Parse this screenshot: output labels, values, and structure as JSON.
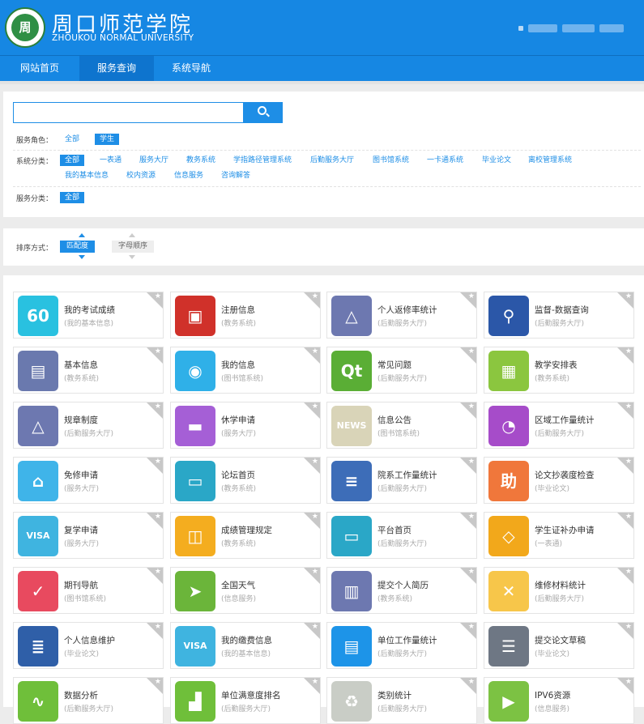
{
  "header": {
    "logo_text": "周",
    "title_cn": "周口师范学院",
    "title_en": "ZHOUKOU NORMAL UNIVERSITY"
  },
  "nav": {
    "items": [
      "网站首页",
      "服务查询",
      "系统导航"
    ],
    "active": 1
  },
  "search": {
    "placeholder": "",
    "button_icon": "search-icon"
  },
  "filters": {
    "role_label": "服务角色：",
    "roles": [
      "全部",
      "学生"
    ],
    "system_label": "系统分类：",
    "systems_row1": [
      "全部",
      "一表通",
      "服务大厅",
      "教务系统",
      "学指路径管理系统",
      "后勤服务大厅",
      "图书馆系统",
      "一卡通系统",
      "毕业论文",
      "离校管理系统"
    ],
    "systems_row2": [
      "我的基本信息",
      "校内资源",
      "信息服务",
      "咨询解答"
    ],
    "category_label": "服务分类：",
    "categories": [
      "全部"
    ]
  },
  "sort": {
    "label": "排序方式：",
    "options": [
      "匹配度",
      "字母顺序"
    ]
  },
  "colors": {
    "primary": "#1687e3",
    "accent": "#1e8ee6"
  },
  "services": [
    {
      "name": "我的考试成绩",
      "sys": "(我的基本信息)",
      "icon": "score-60-icon",
      "color": "#29c1e0",
      "sym": "60"
    },
    {
      "name": "注册信息",
      "sys": "(教务系统)",
      "icon": "id-card-icon",
      "color": "#d0312a",
      "sym": "▣"
    },
    {
      "name": "个人返修率统计",
      "sys": "(后勤服务大厅)",
      "icon": "warning-triangle-icon",
      "color": "#6d78b0",
      "sym": "△"
    },
    {
      "name": "监督-数据查询",
      "sys": "(后勤服务大厅)",
      "icon": "magnifier-icon",
      "color": "#2b57a8",
      "sym": "⚲"
    },
    {
      "name": "基本信息",
      "sys": "(教务系统)",
      "icon": "certificate-icon",
      "color": "#6a79ae",
      "sym": "▤"
    },
    {
      "name": "我的信息",
      "sys": "(图书馆系统)",
      "icon": "user-profile-icon",
      "color": "#2fb0e8",
      "sym": "◉"
    },
    {
      "name": "常见问题",
      "sys": "(后勤服务大厅)",
      "icon": "qt-icon",
      "color": "#5aae35",
      "sym": "Qt"
    },
    {
      "name": "教学安排表",
      "sys": "(教务系统)",
      "icon": "calendar-icon",
      "color": "#8bc63f",
      "sym": "▦"
    },
    {
      "name": "规章制度",
      "sys": "(后勤服务大厅)",
      "icon": "warning-triangle-icon",
      "color": "#6d78b0",
      "sym": "△"
    },
    {
      "name": "休学申请",
      "sys": "(服务大厅)",
      "icon": "bed-icon",
      "color": "#a55fd6",
      "sym": "▬"
    },
    {
      "name": "信息公告",
      "sys": "(图书馆系统)",
      "icon": "news-icon",
      "color": "#d9d4b8",
      "sym": "NEWS"
    },
    {
      "name": "区域工作量统计",
      "sys": "(后勤服务大厅)",
      "icon": "pie-chart-icon",
      "color": "#a64cc9",
      "sym": "◔"
    },
    {
      "name": "免修申请",
      "sys": "(服务大厅)",
      "icon": "school-icon",
      "color": "#3fb4e9",
      "sym": "⌂"
    },
    {
      "name": "论坛首页",
      "sys": "(教务系统)",
      "icon": "monitor-chart-icon",
      "color": "#2aa7c7",
      "sym": "▭"
    },
    {
      "name": "院系工作量统计",
      "sys": "(后勤服务大厅)",
      "icon": "document-icon",
      "color": "#3d6db8",
      "sym": "≡"
    },
    {
      "name": "论文抄袭度检查",
      "sys": "(毕业论文)",
      "icon": "coin-icon",
      "color": "#f0773b",
      "sym": "助"
    },
    {
      "name": "复学申请",
      "sys": "(服务大厅)",
      "icon": "visa-card-icon",
      "color": "#3fb4e0",
      "sym": "VISA"
    },
    {
      "name": "成绩管理规定",
      "sys": "(教务系统)",
      "icon": "card-signal-icon",
      "color": "#f4ad1f",
      "sym": "◫"
    },
    {
      "name": "平台首页",
      "sys": "(后勤服务大厅)",
      "icon": "monitor-chart-icon",
      "color": "#2aa7c7",
      "sym": "▭"
    },
    {
      "name": "学生证补办申请",
      "sys": "(一表通)",
      "icon": "tag-icon",
      "color": "#f2a81b",
      "sym": "◇"
    },
    {
      "name": "期刊导航",
      "sys": "(图书馆系统)",
      "icon": "pocket-icon",
      "color": "#e84a5f",
      "sym": "✓"
    },
    {
      "name": "全国天气",
      "sys": "(信息服务)",
      "icon": "paper-plane-icon",
      "color": "#6bb53a",
      "sym": "➤"
    },
    {
      "name": "提交个人简历",
      "sys": "(教务系统)",
      "icon": "binders-icon",
      "color": "#6d78b0",
      "sym": "▥"
    },
    {
      "name": "维修材料统计",
      "sys": "(后勤服务大厅)",
      "icon": "tools-icon",
      "color": "#f7c64a",
      "sym": "✕"
    },
    {
      "name": "个人信息维护",
      "sys": "(毕业论文)",
      "icon": "notepad-icon",
      "color": "#2f5fa8",
      "sym": "≣"
    },
    {
      "name": "我的缴费信息",
      "sys": "(我的基本信息)",
      "icon": "visa-card-icon",
      "color": "#3fb4e0",
      "sym": "VISA"
    },
    {
      "name": "单位工作量统计",
      "sys": "(后勤服务大厅)",
      "icon": "file-stack-icon",
      "color": "#1d94e8",
      "sym": "▤"
    },
    {
      "name": "提交论文草稿",
      "sys": "(毕业论文)",
      "icon": "list-icon",
      "color": "#6e7784",
      "sym": "☰"
    },
    {
      "name": "数据分析",
      "sys": "(后勤服务大厅)",
      "icon": "chart-icon",
      "color": "#6fbf3a",
      "sym": "∿"
    },
    {
      "name": "单位满意度排名",
      "sys": "(后勤服务大厅)",
      "icon": "podium-icon",
      "color": "#6fbf3a",
      "sym": "▟"
    },
    {
      "name": "类别统计",
      "sys": "(后勤服务大厅)",
      "icon": "recycle-icon",
      "color": "#c9cdc6",
      "sym": "♻"
    },
    {
      "name": "IPV6资源",
      "sys": "(信息服务)",
      "icon": "video-icon",
      "color": "#7cc243",
      "sym": "▶"
    }
  ]
}
